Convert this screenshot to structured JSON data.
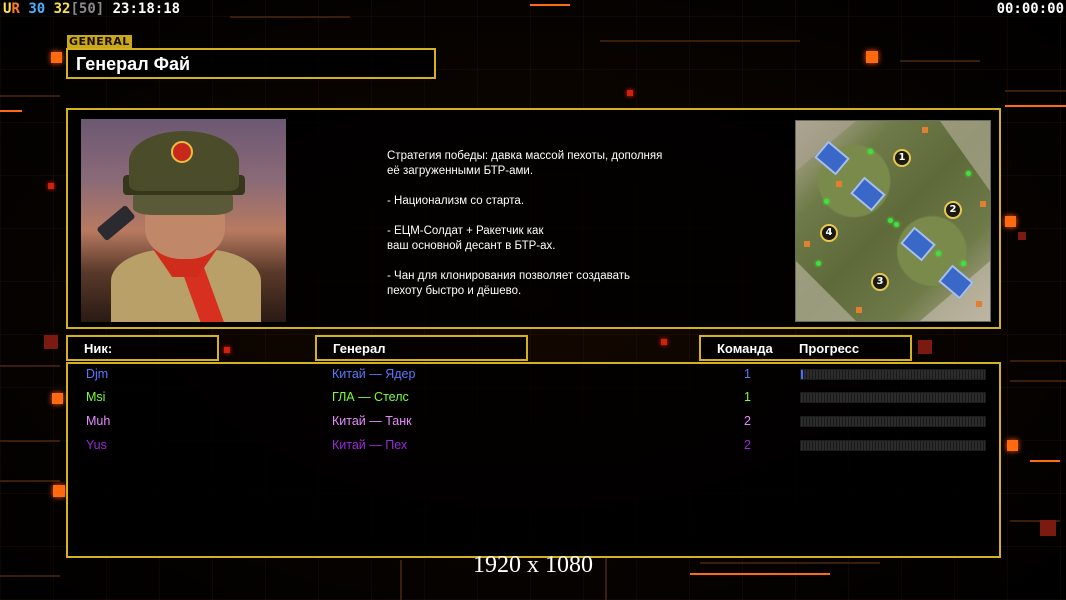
{
  "hud": {
    "ur_u": "U",
    "ur_r": "R",
    "count_a": "30",
    "count_b": "32",
    "count_max": "[50]",
    "clock": "23:18:18",
    "timer": "00:00:00"
  },
  "header": {
    "tag": "GENERAL",
    "title": "Генерал Фай"
  },
  "briefing": {
    "strategy": "Стратегия победы: давка массой пехоты, дополняя\n её загруженными БТР-ами.\n\n- Национализм со старта.\n\n- ЕЦМ-Солдат + Ракетчик как\nваш основной десант в БТР-ах.\n\n- Чан для клонирования позволяет создавать\n пехоту быстро и дёшево."
  },
  "minimap": {
    "start_points": [
      "1",
      "2",
      "3",
      "4"
    ]
  },
  "columns": {
    "nick": "Ник:",
    "general": "Генерал",
    "team": "Команда",
    "progress": "Прогресс"
  },
  "players": [
    {
      "nick": "Djm",
      "general": "Китай — Ядер",
      "team": "1",
      "color": "#5a78ff",
      "progress": 0.01
    },
    {
      "nick": "Msi",
      "general": "ГЛА — Стелс",
      "team": "1",
      "color": "#7aff3a",
      "progress": 0
    },
    {
      "nick": "Muh",
      "general": "Китай — Танк",
      "team": "2",
      "color": "#e88aff",
      "progress": 0
    },
    {
      "nick": "Yus",
      "general": "Китай — Пех",
      "team": "2",
      "color": "#9a2ad8",
      "progress": 0
    }
  ],
  "resolution": "1920 x 1080",
  "colors": {
    "frame": "#d4b21c",
    "accent": "#ff6a10"
  }
}
